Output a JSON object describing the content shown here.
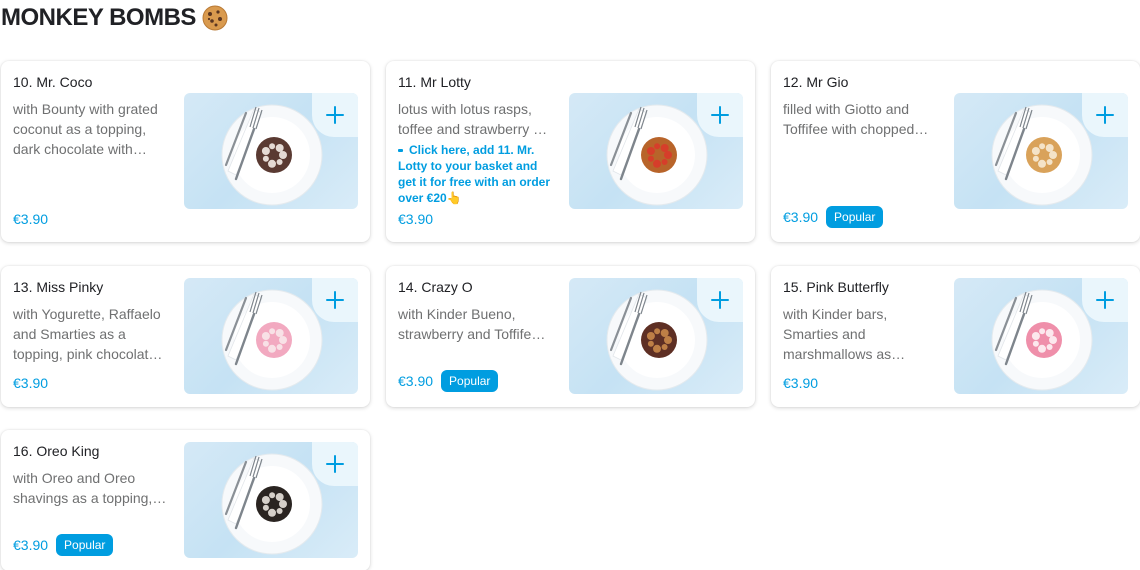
{
  "section": {
    "title": "MONKEY BOMBS",
    "emoji_icon": "cookie-icon"
  },
  "colors": {
    "accent": "#009de0",
    "thumb_bg": "#cfe6f5",
    "text": "#202125",
    "muted": "#6f7071"
  },
  "items": [
    {
      "name": "10. Mr. Coco",
      "description": "with Bounty with grated coconut as a topping, dark chocolate with…",
      "price": "€3.90",
      "badge": "",
      "donut_color": "#5a3a32",
      "topping_color": "#f3ece6"
    },
    {
      "name": "11. Mr Lotty",
      "description": "lotus with lotus rasps, toffee and strawberry …",
      "promo": "Click here, add 11. Mr. Lotty to your basket and get it for free with an order over €20👆",
      "price": "€3.90",
      "badge": "",
      "donut_color": "#b8642a",
      "topping_color": "#d93a2a"
    },
    {
      "name": "12. Mr Gio",
      "description": "filled with Giotto and Toffifee with chopped…",
      "price": "€3.90",
      "badge": "Popular",
      "donut_color": "#d9a25a",
      "topping_color": "#f6ead4"
    },
    {
      "name": "13. Miss Pinky",
      "description": "with Yogurette, Raffaelo and Smarties as a topping, pink chocolat…",
      "price": "€3.90",
      "badge": "",
      "donut_color": "#f2a9c0",
      "topping_color": "#f8e7ea"
    },
    {
      "name": "14. Crazy O",
      "description": "with Kinder Bueno, strawberry and Toffife…",
      "price": "€3.90",
      "badge": "Popular",
      "donut_color": "#5e2f24",
      "topping_color": "#c9884a"
    },
    {
      "name": "15. Pink Butterfly",
      "description": "with Kinder bars, Smarties and marshmallows as…",
      "price": "€3.90",
      "badge": "",
      "donut_color": "#ef8faa",
      "topping_color": "#fdf2f4"
    },
    {
      "name": "16. Oreo King",
      "description": "with Oreo and Oreo shavings as a topping,…",
      "price": "€3.90",
      "badge": "Popular",
      "donut_color": "#2a2421",
      "topping_color": "#e8e2dc"
    }
  ]
}
